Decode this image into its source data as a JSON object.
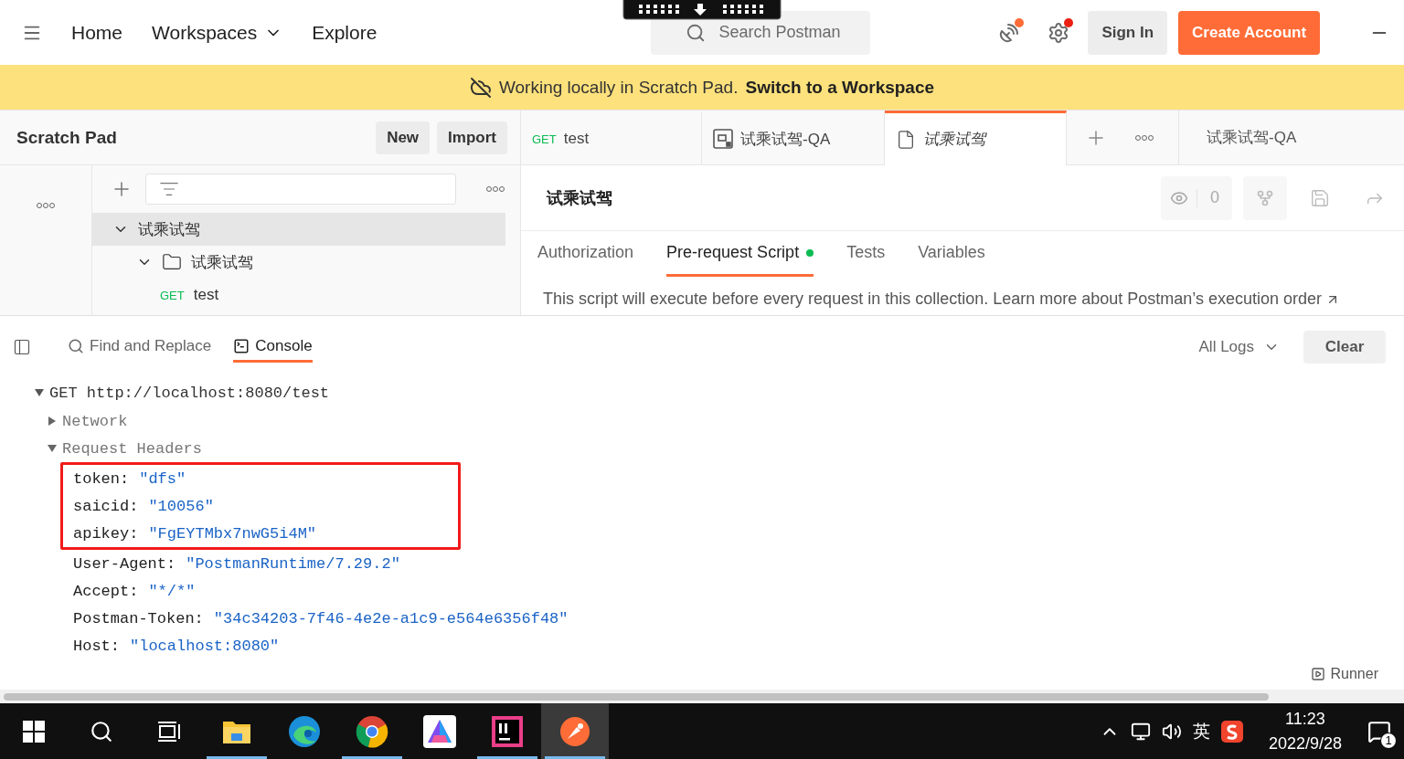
{
  "top_bar": {
    "nav": [
      {
        "label": "Home",
        "kind": "link"
      },
      {
        "label": "Workspaces",
        "kind": "dropdown"
      },
      {
        "label": "Explore",
        "kind": "link"
      }
    ],
    "search": {
      "placeholder": "Search Postman"
    },
    "status_icons": [
      {
        "kind": "satellite",
        "color": "#ff6c37"
      },
      {
        "kind": "settings",
        "color": "#eb2013"
      }
    ],
    "buttons": [
      {
        "label": "Sign In",
        "kind": "secondary"
      },
      {
        "label": "Create Account",
        "kind": "primary"
      }
    ]
  },
  "banner": {
    "message": "Working locally in Scratch Pad.",
    "link": "Switch to a Workspace"
  },
  "sidebar": {
    "title": "Scratch Pad",
    "buttons": [
      "New",
      "Import"
    ],
    "tree": [
      {
        "label": "试乘试驾",
        "kind": "collection",
        "expanded": true,
        "selected": true,
        "children": [
          {
            "label": "试乘试驾",
            "kind": "folder",
            "expanded": true,
            "selected": false,
            "children": [
              {
                "label": "test",
                "kind": "request",
                "method": "GET",
                "selected": false
              }
            ]
          }
        ]
      }
    ]
  },
  "tabs": [
    {
      "kind": "request",
      "method": "GET",
      "label": "test",
      "selected": false,
      "preview": false
    },
    {
      "kind": "environment",
      "label": "试乘试驾-QA",
      "selected": false,
      "preview": false
    },
    {
      "kind": "collection",
      "label": "试乘试驾",
      "selected": true,
      "preview": true
    }
  ],
  "environment": "试乘试驾-QA",
  "collection": {
    "name": "试乘试驾",
    "watchers": "0",
    "subtabs": [
      {
        "label": "Authorization",
        "selected": false,
        "has_content": false
      },
      {
        "label": "Pre-request Script",
        "selected": true,
        "has_content": true
      },
      {
        "label": "Tests",
        "selected": false,
        "has_content": false
      },
      {
        "label": "Variables",
        "selected": false,
        "has_content": false
      }
    ],
    "description": "This script will execute before every request in this collection.",
    "link": "Learn more about Postman’s execution order"
  },
  "console": {
    "tools": [
      {
        "label": "Find and Replace",
        "kind": "find",
        "selected": false
      },
      {
        "label": "Console",
        "kind": "console",
        "selected": true
      }
    ],
    "filter": "All Logs",
    "clear": "Clear",
    "entries": [
      {
        "method": "GET",
        "url": "http://localhost:8080/test",
        "expanded": true,
        "sections": [
          {
            "label": "Network",
            "expanded": false
          },
          {
            "label": "Request Headers",
            "expanded": true,
            "headers": [
              {
                "key": "token:",
                "value": "\"dfs\"",
                "highlighted": true
              },
              {
                "key": "saicid:",
                "value": "\"10056\"",
                "highlighted": true
              },
              {
                "key": "apikey:",
                "value": "\"FgEYTMbx7nwG5i4M\"",
                "highlighted": true
              },
              {
                "key": "User-Agent:",
                "value": "\"PostmanRuntime/7.29.2\"",
                "highlighted": false
              },
              {
                "key": "Accept:",
                "value": "\"*/*\"",
                "highlighted": false
              },
              {
                "key": "Postman-Token:",
                "value": "\"34c34203-7f46-4e2e-a1c9-e564e6356f48\"",
                "highlighted": false
              },
              {
                "key": "Host:",
                "value": "\"localhost:8080\"",
                "highlighted": false
              }
            ]
          }
        ]
      }
    ]
  },
  "status_bar": {
    "runner": "Runner"
  },
  "taskbar": {
    "apps": [
      {
        "kind": "start",
        "running": false,
        "selected": false
      },
      {
        "kind": "search",
        "running": false,
        "selected": false
      },
      {
        "kind": "taskview",
        "running": false,
        "selected": false
      },
      {
        "kind": "files",
        "running": true,
        "selected": false
      },
      {
        "kind": "edge",
        "running": false,
        "selected": false
      },
      {
        "kind": "chrome",
        "running": true,
        "selected": false
      },
      {
        "kind": "triangle",
        "running": false,
        "selected": false
      },
      {
        "kind": "ide",
        "running": true,
        "selected": false
      },
      {
        "kind": "postman",
        "running": true,
        "selected": true
      }
    ],
    "ime": "英",
    "time": "11:23",
    "date": "2022/9/28",
    "notifications": "1"
  }
}
